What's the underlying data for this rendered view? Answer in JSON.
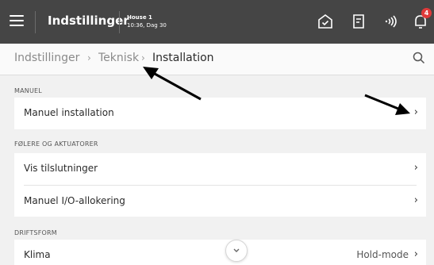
{
  "header": {
    "title": "Indstillinger",
    "house_name": "House 1",
    "house_status": "10:36, Dag 30",
    "notification_count": "4"
  },
  "breadcrumb": {
    "items": [
      "Indstillinger",
      "Teknisk",
      "Installation"
    ],
    "separator": "›"
  },
  "sections": [
    {
      "label": "MANUEL",
      "items": [
        {
          "label": "Manuel installation",
          "value": "",
          "chevron": "›"
        }
      ]
    },
    {
      "label": "FØLERE OG AKTUATORER",
      "items": [
        {
          "label": "Vis tilslutninger",
          "value": "",
          "chevron": "›"
        },
        {
          "label": "Manuel I/O-allokering",
          "value": "",
          "chevron": "›"
        }
      ]
    },
    {
      "label": "DRIFTSFORM",
      "items": [
        {
          "label": "Klima",
          "value": "Hold-mode",
          "chevron": "›"
        }
      ]
    }
  ],
  "colors": {
    "topbar": "#454545",
    "background": "#f1f1f1",
    "badge": "#e03a3a",
    "annotation_arrow": "#000000"
  }
}
